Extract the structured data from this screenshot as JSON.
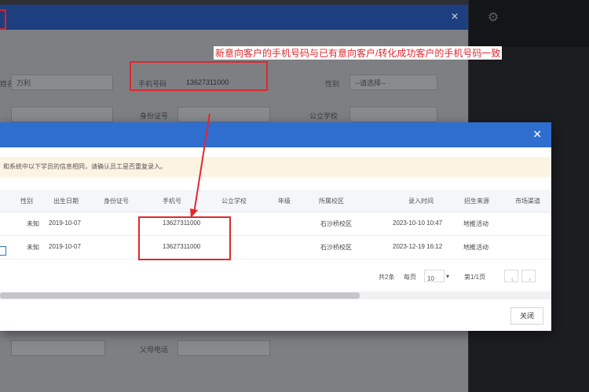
{
  "back_dialog": {
    "fields": {
      "name_label": "姓名",
      "name_value": "万利",
      "phone_label": "手机号码",
      "phone_value": "13627311000",
      "gender_label": "性别",
      "gender_value": "--请选择--",
      "id_label": "身份证号",
      "school_label": "公立学校",
      "parent_phone_label": "父母电话"
    }
  },
  "front_dialog": {
    "notice": "和系统中以下学员的信息相同，请确认员工是否重复录入。",
    "annotation": "新意向客户的手机号码与已有意向客户/转化成功客户的手机号码一致",
    "columns": [
      "性别",
      "出生日期",
      "身份证号",
      "手机号",
      "公立学校",
      "年级",
      "所属校区",
      "录入时间",
      "招生来源",
      "市场渠道"
    ],
    "rows": [
      {
        "gender": "未知",
        "birth": "2019-10-07",
        "phone": "13627311000",
        "campus": "石沙桥校区",
        "entry": "2023-10-10 10:47",
        "source": "地推活动"
      },
      {
        "gender": "未知",
        "birth": "2019-10-07",
        "phone": "13627311000",
        "campus": "石沙桥校区",
        "entry": "2023-12-19 16:12",
        "source": "地推活动"
      }
    ],
    "pager": {
      "total": "共2条",
      "per_page_label": "每页",
      "per_page_value": "10",
      "page_info": "第1/1页",
      "prev": "‹",
      "next": "›"
    },
    "close_label": "关闭"
  },
  "colors": {
    "header_blue": "#2f6ecf",
    "highlight_red": "#e0282e",
    "notice_bg": "#fdf3e3"
  }
}
